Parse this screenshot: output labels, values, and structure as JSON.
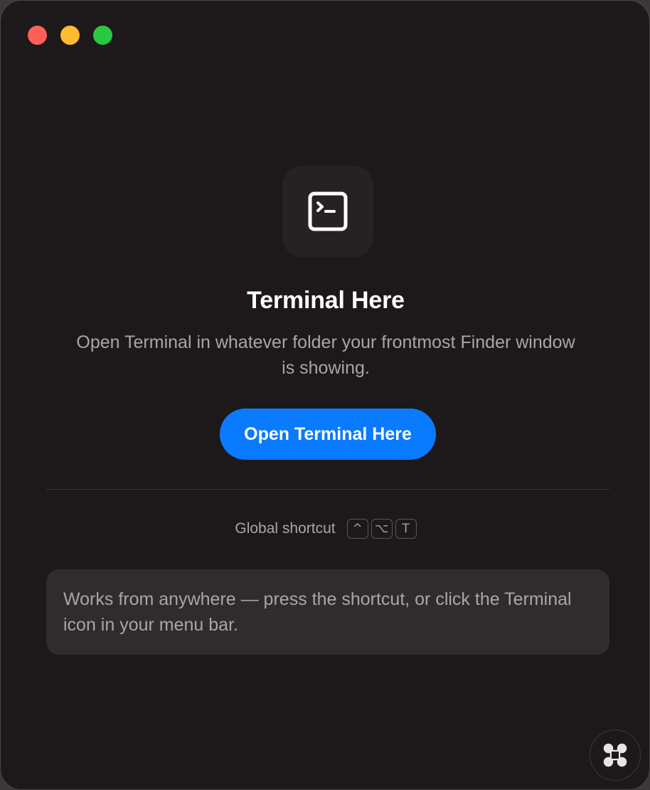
{
  "window": {
    "controls": {
      "close": "close-button",
      "minimize": "minimize-button",
      "zoom": "zoom-button"
    }
  },
  "app": {
    "icon": "terminal-icon",
    "title": "Terminal Here",
    "description": "Open Terminal in whatever folder your frontmost Finder window is showing.",
    "primary_button_label": "Open Terminal Here"
  },
  "shortcut": {
    "label": "Global shortcut",
    "keys": [
      "^",
      "⌥",
      "T"
    ]
  },
  "info": {
    "text": "Works from anywhere — press the shortcut, or click the Terminal icon in your menu bar."
  },
  "corner_button": {
    "icon": "command-icon"
  },
  "colors": {
    "background": "#1d1819",
    "accent": "#0a7aff",
    "text_primary": "#ffffff",
    "text_secondary": "#aaa5a6",
    "card": "#302b2c"
  }
}
